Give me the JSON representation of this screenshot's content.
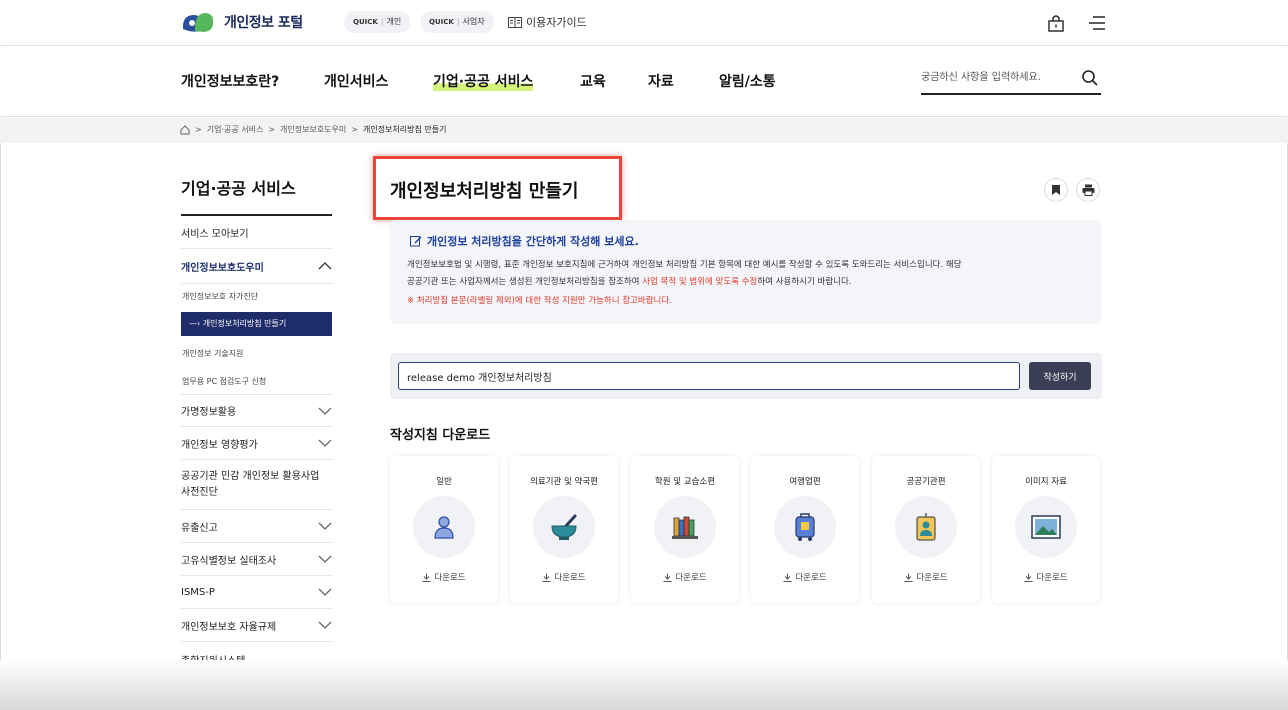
{
  "topbar": {
    "logo_text": "개인정보 포털",
    "quick_label": "QUICK",
    "quick_personal": "개인",
    "quick_business": "사업자",
    "guide": "이용자가이드"
  },
  "gnb": {
    "items": [
      "개인정보보호란?",
      "개인서비스",
      "기업·공공 서비스",
      "교육",
      "자료",
      "알림/소통"
    ],
    "active_index": 2,
    "search_placeholder": "궁금하신 사항을 입력하세요."
  },
  "breadcrumb": [
    "기업·공공 서비스",
    "개인정보보호도우미",
    "개인정보처리방침 만들기"
  ],
  "sidebar": {
    "title": "기업·공공 서비스",
    "items": [
      {
        "label": "서비스 모아보기"
      },
      {
        "label": "개인정보보호도우미",
        "open": true,
        "subs": [
          "개인정보보호 자가진단",
          "개인정보처리방침 만들기",
          "개인정보 기술지원",
          "업무용 PC 점검도구 신청"
        ],
        "active_sub": 1
      },
      {
        "label": "가명정보활용"
      },
      {
        "label": "개인정보 영향평가"
      },
      {
        "label": "공공기관 민감 개인정보 활용사업 사전진단"
      },
      {
        "label": "유출신고"
      },
      {
        "label": "고유식별정보 실태조사"
      },
      {
        "label": "ISMS-P"
      },
      {
        "label": "개인정보보호 자율규제"
      },
      {
        "label": "종합지원시스템"
      }
    ]
  },
  "main": {
    "title": "개인정보처리방침 만들기",
    "info_head": "개인정보 처리방침을 간단하게 작성해 보세요.",
    "info_body_1": "개인정보보호법 및 시행령, 표준 개인정보 보호지침에 근거하여 개인정보 처리방침 기본 항목에 대한 예시를 작성할 수 있도록 도와드리는 서비스입니다. 해당",
    "info_body_2a": "공공기관 또는 사업자께서는 생성된 개인정보처리방침을 참조하여 ",
    "info_body_2b": "사업 목적 및 범위에 맞도록 수정",
    "info_body_2c": "하여 사용하시기 바랍니다.",
    "info_note": "※ 처리방침 본문(라벨링 제외)에 대한 작성 지원만 가능하니 참고바랍니다.",
    "input_value": "release demo 개인정보처리방침",
    "write_button": "작성하기",
    "download_title": "작성지침 다운로드",
    "download_label": "다운로드",
    "cards": [
      {
        "label": "일반",
        "icon": "person-icon"
      },
      {
        "label": "의료기관 및 약국편",
        "icon": "mortar-pestle-icon"
      },
      {
        "label": "학원 및 교습소편",
        "icon": "books-icon"
      },
      {
        "label": "여행업편",
        "icon": "luggage-icon"
      },
      {
        "label": "공공기관편",
        "icon": "id-badge-icon"
      },
      {
        "label": "이미지 자료",
        "icon": "image-icon"
      }
    ]
  },
  "colors": {
    "brand_navy": "#1f2c6a",
    "accent_red": "#e8443a",
    "highlight_green": "#d6f27a",
    "link_blue": "#1f3f9e"
  }
}
